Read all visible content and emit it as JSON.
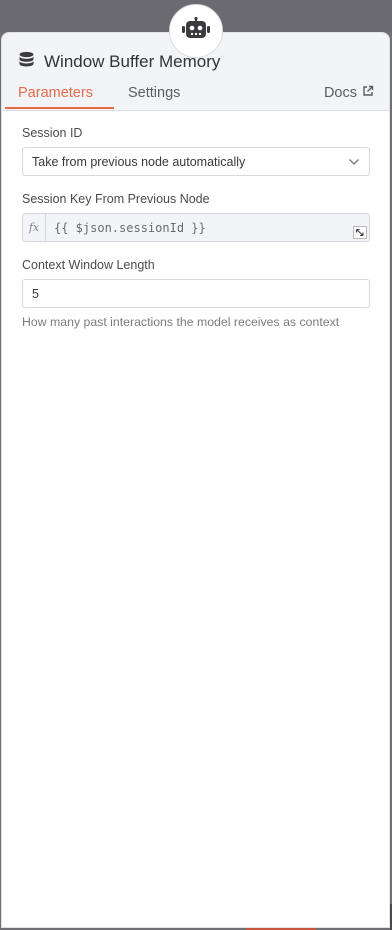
{
  "node": {
    "title": "Window Buffer Memory",
    "badge_icon": "robot-icon",
    "title_icon": "database-icon"
  },
  "tabs": {
    "parameters": "Parameters",
    "settings": "Settings",
    "docs": "Docs"
  },
  "fields": {
    "session_id": {
      "label": "Session ID",
      "value": "Take from previous node automatically"
    },
    "session_key": {
      "label": "Session Key From Previous Node",
      "value": "{{ $json.sessionId }}"
    },
    "context_window": {
      "label": "Context Window Length",
      "value": "5",
      "hint": "How many past interactions the model receives as context"
    }
  },
  "colors": {
    "accent": "#e56a4a"
  }
}
